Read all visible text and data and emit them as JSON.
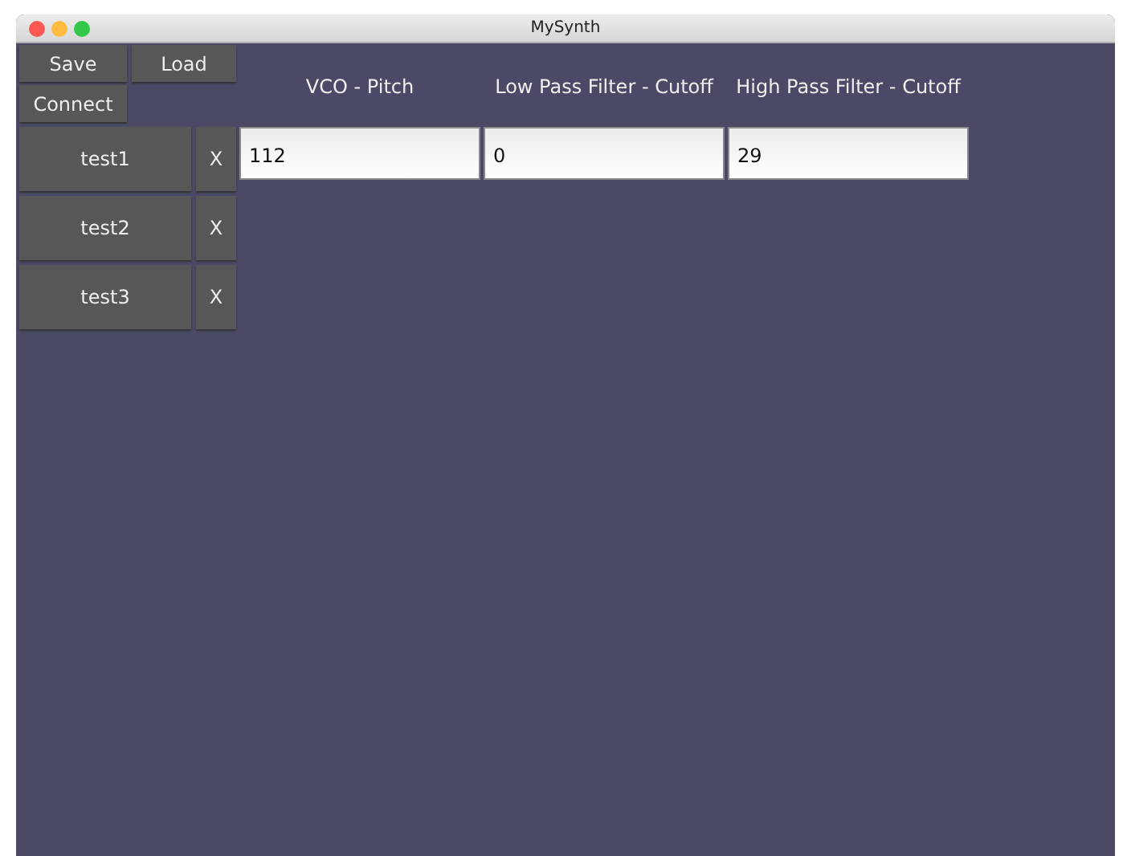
{
  "window": {
    "title": "MySynth"
  },
  "toolbar": {
    "buttons": [
      "Save",
      "Load",
      "Connect"
    ]
  },
  "presets": [
    {
      "name": "test1",
      "delete": "X"
    },
    {
      "name": "test2",
      "delete": "X"
    },
    {
      "name": "test3",
      "delete": "X"
    }
  ],
  "parameters": [
    {
      "label": "VCO - Pitch",
      "value": "112"
    },
    {
      "label": "Low Pass Filter - Cutoff",
      "value": "0"
    },
    {
      "label": "High Pass Filter - Cutoff",
      "value": "29"
    }
  ]
}
